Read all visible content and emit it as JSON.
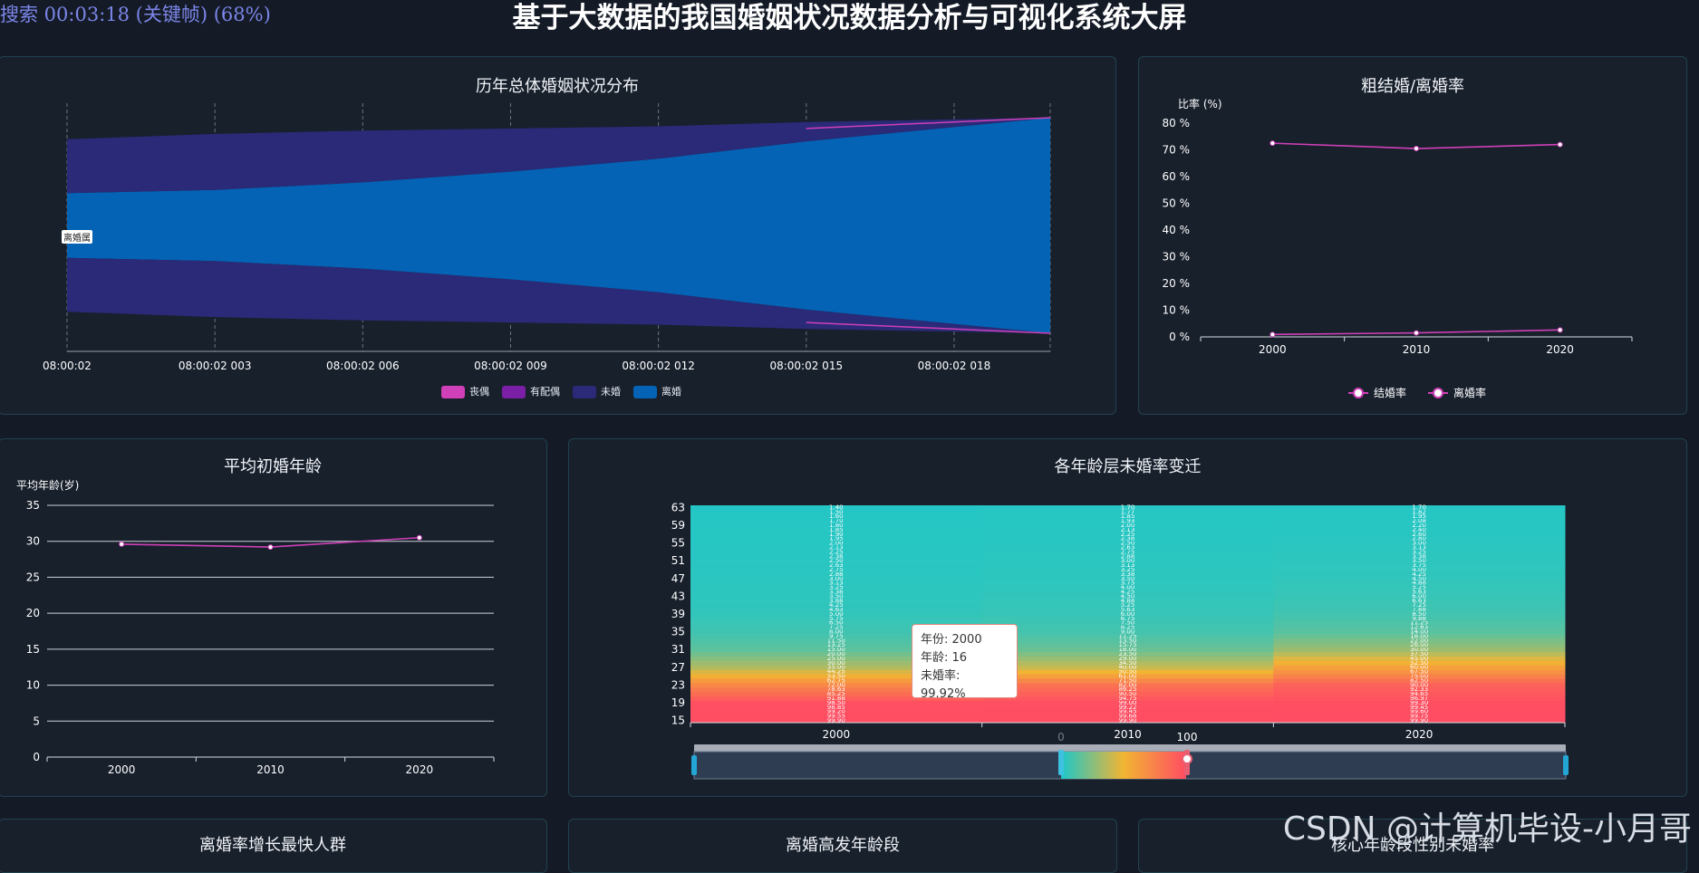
{
  "header": {
    "title": "基于大数据的我国婚姻状况数据分析与可视化系统大屏"
  },
  "overlay": {
    "recording_text": "搜索 00:03:18 (关键帧) (68%)"
  },
  "watermark": "CSDN @计算机毕设-小月哥",
  "colors": {
    "bg": "#141b27",
    "panel": "#18202c",
    "border": "#21424e",
    "accent_pink": "#d040b8",
    "accent_purple": "#7a1fa6",
    "dark_purple": "#2a2a78",
    "blue": "#0463b4"
  },
  "panels": {
    "stream": {
      "title": "历年总体婚姻状况分布",
      "tag_label": "离婚属"
    },
    "rate": {
      "title": "粗结婚/离婚率"
    },
    "age": {
      "title": "平均初婚年龄"
    },
    "heat": {
      "title": "各年龄层未婚率变迁"
    },
    "bottom1": {
      "title": "离婚率增长最快人群"
    },
    "bottom2": {
      "title": "离婚高发年龄段"
    },
    "bottom3": {
      "title": "核心年龄段性别未婚率"
    }
  },
  "tooltip": {
    "line1": "年份: 2000",
    "line2": "年龄: 16",
    "line3": "未婚率: 99.92%"
  },
  "chart_data": [
    {
      "type": "area",
      "title": "历年总体婚姻状况分布",
      "x": [
        "08:00:02",
        "08:00:02 003",
        "08:00:02 006",
        "08:00:02 009",
        "08:00:02 012",
        "08:00:02 015",
        "08:00:02 018"
      ],
      "legend": [
        "丧偶",
        "有配偶",
        "未婚",
        "离婚"
      ],
      "legend_placement": "bottom",
      "series": [
        {
          "name": "离婚",
          "color": "#0463b4",
          "values": [
            0.3,
            0.33,
            0.4,
            0.5,
            0.62,
            0.78,
            1.0
          ]
        },
        {
          "name": "未婚",
          "color": "#2a2a78",
          "values": [
            0.5,
            0.52,
            0.48,
            0.4,
            0.3,
            0.18,
            0.0
          ]
        },
        {
          "name": "有配偶",
          "color": "#7a1fa6",
          "values": [
            0.0,
            0.0,
            0.0,
            0.0,
            0.0,
            0.0,
            0.0
          ]
        },
        {
          "name": "丧偶",
          "color": "#d040b8",
          "values": [
            0.0,
            0.0,
            0.0,
            0.0,
            0.0,
            0.0,
            0.0
          ]
        }
      ]
    },
    {
      "type": "line",
      "title": "粗结婚/离婚率",
      "ylabel": "比率 (%)",
      "ylim": [
        0,
        80
      ],
      "yticks": [
        "0 %",
        "10 %",
        "20 %",
        "30 %",
        "40 %",
        "50 %",
        "60 %",
        "70 %",
        "80 %"
      ],
      "categories": [
        "2000",
        "2010",
        "2020"
      ],
      "legend": [
        "结婚率",
        "离婚率"
      ],
      "legend_placement": "bottom",
      "series": [
        {
          "name": "结婚率",
          "color": "#d040b8",
          "values": [
            72.5,
            70.5,
            72
          ]
        },
        {
          "name": "离婚率",
          "color": "#d040b8",
          "values": [
            0.9,
            1.5,
            2.6
          ]
        }
      ]
    },
    {
      "type": "line",
      "title": "平均初婚年龄",
      "ylabel": "平均年龄(岁)",
      "ylim": [
        0,
        35
      ],
      "yticks": [
        "0",
        "5",
        "10",
        "15",
        "20",
        "25",
        "30",
        "35"
      ],
      "categories": [
        "2000",
        "2010",
        "2020"
      ],
      "grid": true,
      "series": [
        {
          "values": [
            29.6,
            29.2,
            30.5
          ],
          "color": "#d040b8"
        }
      ]
    },
    {
      "type": "heatmap",
      "title": "各年龄层未婚率变迁",
      "categories": [
        "2000",
        "2010",
        "2020"
      ],
      "ages": [
        15,
        19,
        23,
        27,
        31,
        35,
        39,
        43,
        47,
        51,
        55,
        59,
        63
      ],
      "unmarried_rate": [
        [
          99.9,
          98.5,
          72.0,
          35.0,
          15.0,
          8.0,
          5.0,
          3.5,
          3.0,
          2.5,
          2.0,
          1.8,
          1.4
        ],
        [
          99.9,
          99.0,
          82.0,
          40.0,
          18.0,
          9.0,
          6.0,
          4.5,
          3.5,
          3.0,
          2.5,
          2.0,
          1.7
        ],
        [
          99.9,
          99.3,
          90.0,
          60.0,
          30.0,
          14.0,
          8.5,
          6.0,
          4.5,
          3.5,
          3.0,
          2.2,
          1.7
        ]
      ],
      "visual_map": {
        "min": "0",
        "max": "100"
      }
    }
  ]
}
